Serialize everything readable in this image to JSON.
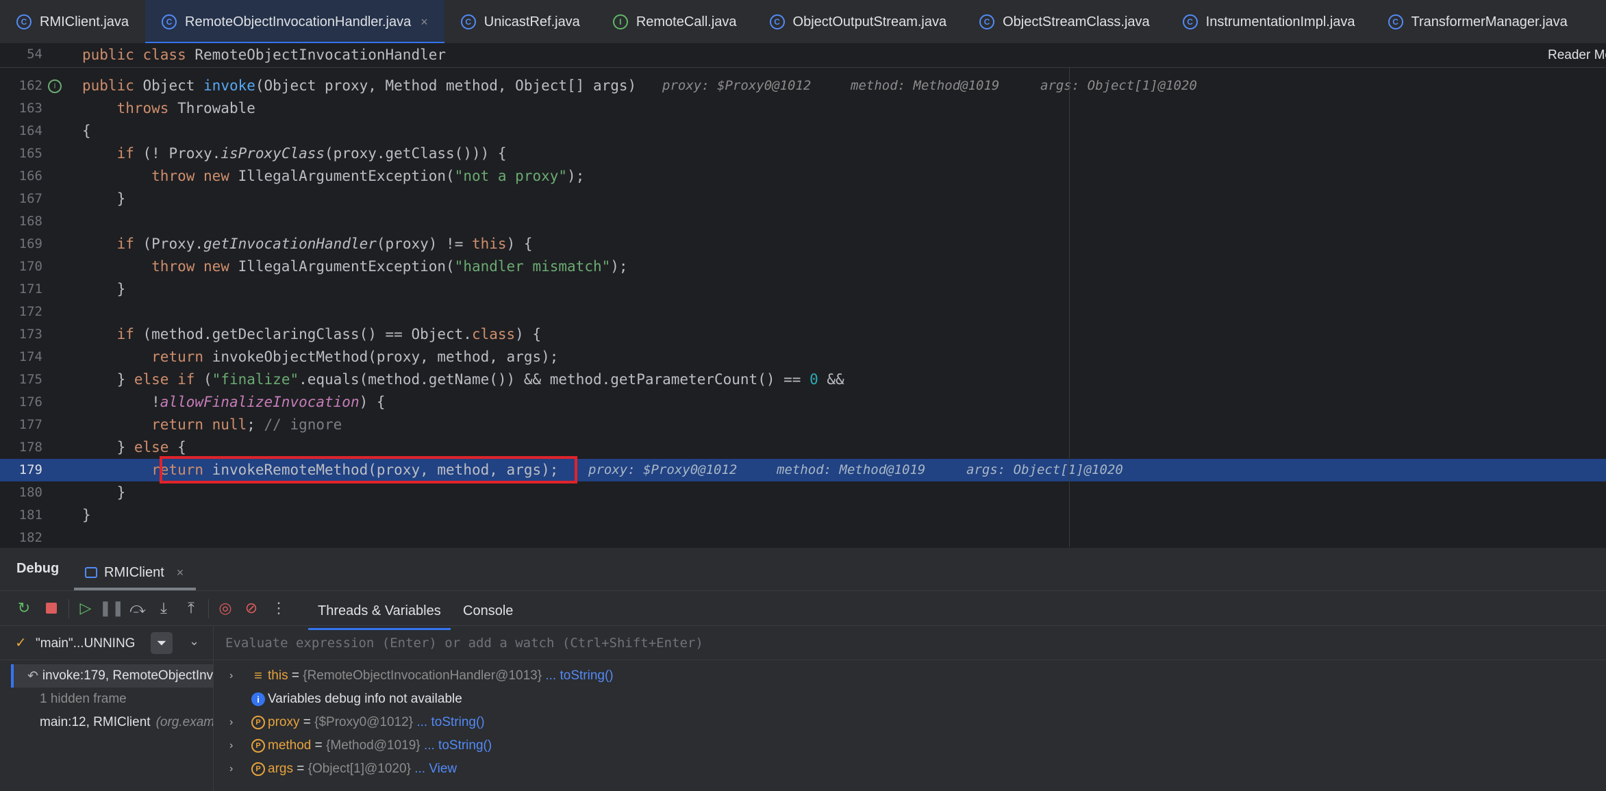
{
  "tabs": [
    {
      "label": "RMIClient.java",
      "icon": "class-icon",
      "active": false
    },
    {
      "label": "RemoteObjectInvocationHandler.java",
      "icon": "class-icon",
      "active": true
    },
    {
      "label": "UnicastRef.java",
      "icon": "class-icon",
      "active": false
    },
    {
      "label": "RemoteCall.java",
      "icon": "interface-icon",
      "active": false
    },
    {
      "label": "ObjectOutputStream.java",
      "icon": "class-icon",
      "active": false
    },
    {
      "label": "ObjectStreamClass.java",
      "icon": "class-icon",
      "active": false
    },
    {
      "label": "InstrumentationImpl.java",
      "icon": "class-icon",
      "active": false
    },
    {
      "label": "TransformerManager.java",
      "icon": "class-icon",
      "active": false
    }
  ],
  "sticky": {
    "line": "54",
    "code": "public class RemoteObjectInvocationHandler"
  },
  "reader_mode": "Reader Mode",
  "editor": {
    "lines": [
      "162",
      "163",
      "164",
      "165",
      "166",
      "167",
      "168",
      "169",
      "170",
      "171",
      "172",
      "173",
      "174",
      "175",
      "176",
      "177",
      "178",
      "179",
      "180",
      "181",
      "182"
    ],
    "hints_162": {
      "proxy": "proxy: $Proxy0@1012",
      "method": "method: Method@1019",
      "args": "args: Object[1]@1020"
    },
    "hints_179": {
      "proxy": "proxy: $Proxy0@1012",
      "method": "method: Method@1019",
      "args": "args: Object[1]@1020"
    },
    "current_line": "179"
  },
  "debug": {
    "title": "Debug",
    "session_tab": "RMIClient",
    "subtabs": [
      "Threads & Variables",
      "Console"
    ],
    "thread": "\"main\"...UNNING",
    "frames": [
      {
        "label": "invoke:179, RemoteObjectInv",
        "extra": ""
      },
      {
        "label": "1 hidden frame",
        "extra": ""
      },
      {
        "label": "main:12, RMIClient",
        "extra": "(org.exam"
      }
    ],
    "eval_placeholder": "Evaluate expression (Enter) or add a watch (Ctrl+Shift+Enter)",
    "variables": [
      {
        "name": "this",
        "value": "{RemoteObjectInvocationHandler@1013}",
        "link": "... toString()",
        "icon": "stack-icon",
        "expandable": true
      },
      {
        "name": "",
        "value": "Variables debug info not available",
        "link": "",
        "icon": "info-icon",
        "expandable": false
      },
      {
        "name": "proxy",
        "value": "{$Proxy0@1012}",
        "link": "... toString()",
        "icon": "param-icon",
        "expandable": true
      },
      {
        "name": "method",
        "value": "{Method@1019}",
        "link": "... toString()",
        "icon": "param-icon",
        "expandable": true
      },
      {
        "name": "args",
        "value": "{Object[1]@1020}",
        "link": "... View",
        "icon": "param-icon",
        "expandable": true
      }
    ]
  },
  "colors": {
    "accent": "#3574f0",
    "highlight_line": "#214283",
    "red_box": "#e0232b"
  }
}
